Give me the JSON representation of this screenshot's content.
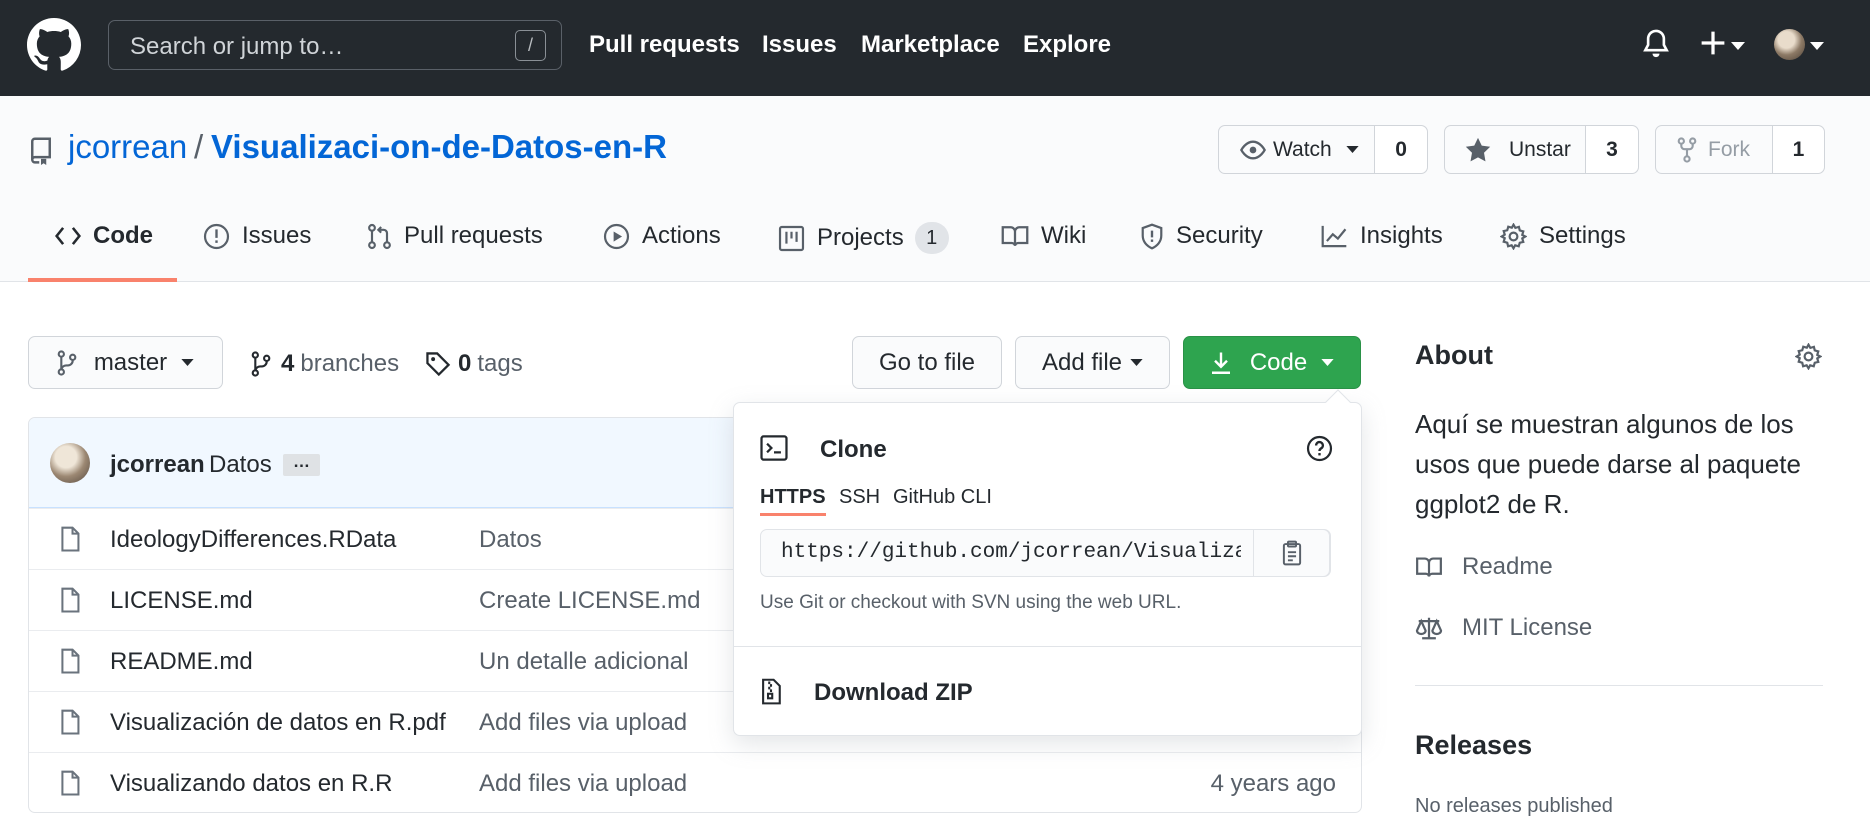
{
  "header": {
    "search_placeholder": "Search or jump to…",
    "search_shortcut": "/",
    "nav": [
      "Pull requests",
      "Issues",
      "Marketplace",
      "Explore"
    ]
  },
  "repo": {
    "owner": "jcorrean",
    "separator": "/",
    "name": "Visualizaci-on-de-Datos-en-R",
    "watch_label": "Watch",
    "watch_count": "0",
    "star_label": "Unstar",
    "star_count": "3",
    "fork_label": "Fork",
    "fork_count": "1"
  },
  "tabs": {
    "code": "Code",
    "issues": "Issues",
    "pull_requests": "Pull requests",
    "actions": "Actions",
    "projects": "Projects",
    "projects_count": "1",
    "wiki": "Wiki",
    "security": "Security",
    "insights": "Insights",
    "settings": "Settings"
  },
  "toolbar": {
    "branch": "master",
    "branches_count": "4",
    "branches_label": "branches",
    "tags_count": "0",
    "tags_label": "tags",
    "go_to_file": "Go to file",
    "add_file": "Add file",
    "code": "Code"
  },
  "commit": {
    "user": "jcorrean",
    "message": "Datos",
    "ellipsis": "…"
  },
  "files": [
    {
      "name": "IdeologyDifferences.RData",
      "message": "Datos",
      "age": ""
    },
    {
      "name": "LICENSE.md",
      "message": "Create LICENSE.md",
      "age": ""
    },
    {
      "name": "README.md",
      "message": "Un detalle adicional",
      "age": ""
    },
    {
      "name": "Visualización de datos en R.pdf",
      "message": "Add files via upload",
      "age": ""
    },
    {
      "name": "Visualizando datos en R.R",
      "message": "Add files via upload",
      "age": "4 years ago"
    }
  ],
  "clone": {
    "title": "Clone",
    "tabs": [
      "HTTPS",
      "SSH",
      "GitHub CLI"
    ],
    "url": "https://github.com/jcorrean/Visualizac",
    "hint": "Use Git or checkout with SVN using the web URL.",
    "download_zip": "Download ZIP"
  },
  "sidebar": {
    "about_title": "About",
    "description": "Aquí se muestran algunos de los usos que puede darse al paquete ggplot2 de R.",
    "readme": "Readme",
    "license": "MIT License",
    "releases_title": "Releases",
    "releases_none": "No releases published"
  },
  "colors": {
    "header_bg": "#24292e",
    "link": "#0366d6",
    "primary_button": "#2ea44f",
    "tab_underline": "#f9826c"
  }
}
